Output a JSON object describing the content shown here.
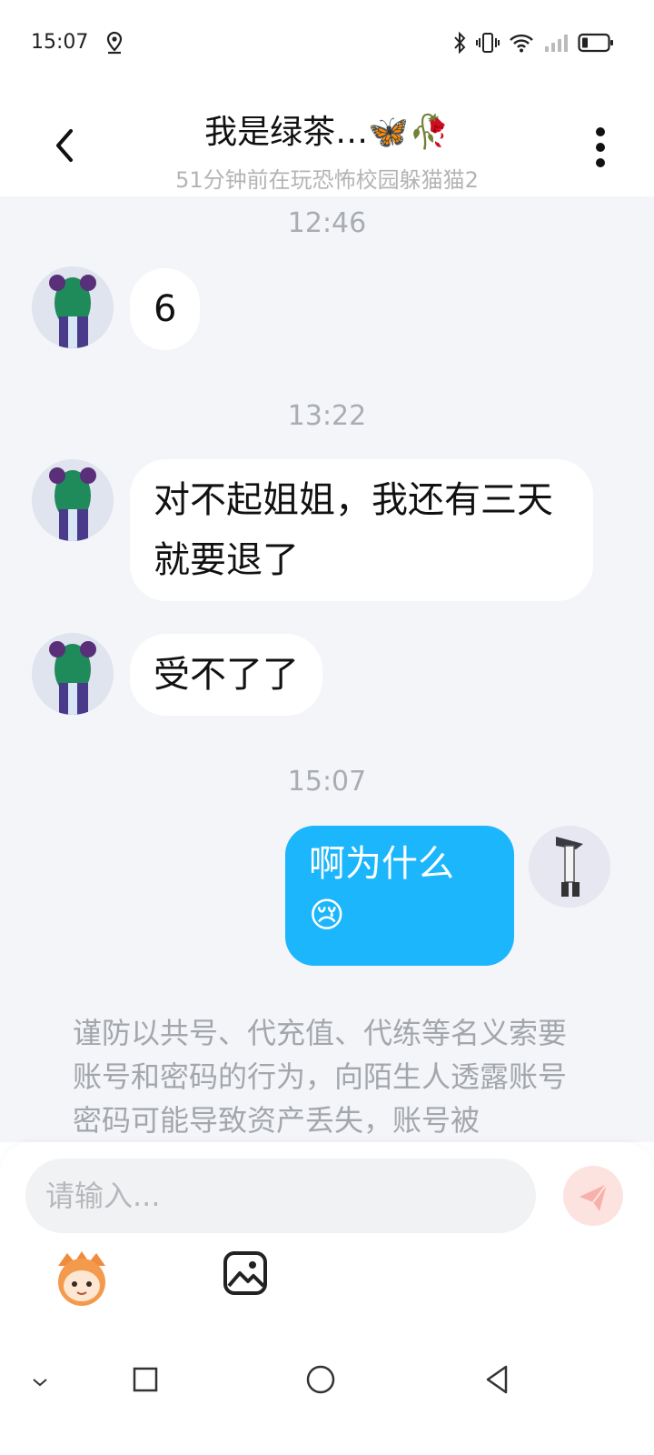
{
  "status_bar": {
    "time": "15:07",
    "icons": [
      "location-icon",
      "bluetooth-icon",
      "vibrate-icon",
      "wifi-icon",
      "signal-icon",
      "battery-icon"
    ]
  },
  "header": {
    "back_icon": "chevron-left-icon",
    "title": "我是绿茶…🦋🥀",
    "subtitle": "51分钟前在玩恐怖校园躲猫猫2",
    "more_icon": "more-vertical-icon"
  },
  "chat": {
    "messages": [
      {
        "timestamp": "12:46",
        "sender": "other",
        "text": "6"
      },
      {
        "timestamp": "13:22",
        "sender": "other",
        "text": "对不起姐姐，我还有三天就要退了"
      },
      {
        "sender": "other",
        "text": "受不了了"
      },
      {
        "timestamp": "15:07",
        "sender": "me",
        "text": "啊为什么",
        "emoji": "😢"
      }
    ],
    "safety_notice": "谨防以共号、代充值、代练等名义索要账号和密码的行为，向陌生人透露账号密码可能导致资产丢失，账号被"
  },
  "composer": {
    "placeholder": "请输入...",
    "send_icon": "paper-plane-icon",
    "emoji_icon": "mascot-emoji-icon",
    "image_icon": "image-icon"
  },
  "nav_bar": {
    "icons": [
      "hide-keyboard-icon",
      "recents-icon",
      "home-icon",
      "back-icon"
    ]
  },
  "colors": {
    "chat_background": "#f3f5f9",
    "my_bubble": "#1bb6fb",
    "other_bubble": "#ffffff",
    "send_button": "#fde3e0",
    "send_arrow": "#f5a9a2",
    "timestamp_text": "#a9adb3"
  }
}
